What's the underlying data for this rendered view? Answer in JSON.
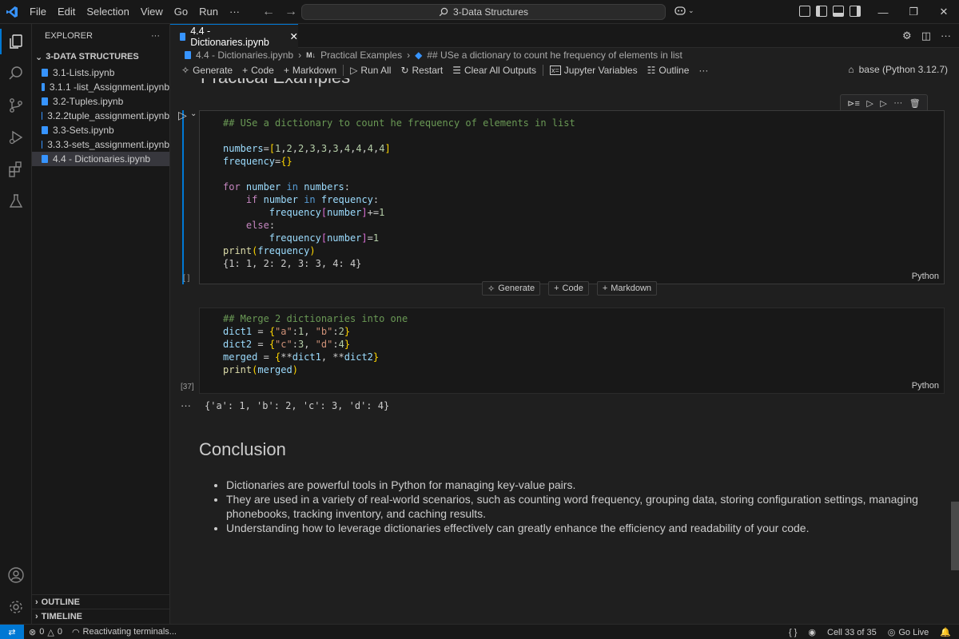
{
  "menu": {
    "file": "File",
    "edit": "Edit",
    "selection": "Selection",
    "view": "View",
    "go": "Go",
    "run": "Run",
    "more": "···"
  },
  "command_center": {
    "text": "3-Data Structures"
  },
  "sidebar": {
    "title": "EXPLORER",
    "root": "3-DATA STRUCTURES",
    "files": [
      "3.1-Lists.ipynb",
      "3.1.1 -list_Assignment.ipynb",
      "3.2-Tuples.ipynb",
      "3.2.2tuple_assignment.ipynb",
      "3.3-Sets.ipynb",
      "3.3.3-sets_assignment.ipynb",
      "4.4 - Dictionaries.ipynb"
    ],
    "outline": "OUTLINE",
    "timeline": "TIMELINE"
  },
  "tab": {
    "label": "4.4 - Dictionaries.ipynb"
  },
  "breadcrumb": {
    "file": "4.4 - Dictionaries.ipynb",
    "md_badge": "M↓",
    "section": "Practical Examples",
    "cell": "## USe a dictionary to count he frequency of elements in list"
  },
  "toolbar": {
    "generate": "Generate",
    "code": "Code",
    "markdown": "Markdown",
    "run_all": "Run All",
    "restart": "Restart",
    "clear": "Clear All Outputs",
    "jupyter_vars": "Jupyter Variables",
    "outline": "Outline",
    "more": "···",
    "kernel": "base (Python 3.12.7)"
  },
  "notebook": {
    "ghost_heading": "Practical Examples",
    "cell1": {
      "exec": "[ ]",
      "lang": "Python",
      "comment": "## USe a dictionary to count he frequency of elements in list",
      "output": "{1: 1, 2: 2, 3: 3, 4: 4}"
    },
    "insert": {
      "generate": "Generate",
      "code": "Code",
      "markdown": "Markdown"
    },
    "cell2": {
      "exec": "[37]",
      "lang": "Python",
      "comment": "## Merge 2 dictionaries into one",
      "output": "{'a': 1, 'b': 2, 'c': 3, 'd': 4}"
    },
    "conclusion": {
      "heading": "Conclusion",
      "bullets": [
        "Dictionaries are powerful tools in Python for managing key-value pairs.",
        "They are used in a variety of real-world scenarios, such as counting word frequency, grouping data, storing configuration settings, managing phonebooks, tracking inventory, and caching results.",
        "Understanding how to leverage dictionaries effectively can greatly enhance the efficiency and readability of your code."
      ]
    }
  },
  "status": {
    "errors": "0",
    "warnings": "0",
    "activity": "Reactivating terminals...",
    "braces": "{ }",
    "cell_pos": "Cell 33 of 35",
    "go_live": "Go Live"
  },
  "colors": {
    "accent": "#0078d4",
    "background": "#1f1f1f",
    "sidebar": "#181818"
  }
}
